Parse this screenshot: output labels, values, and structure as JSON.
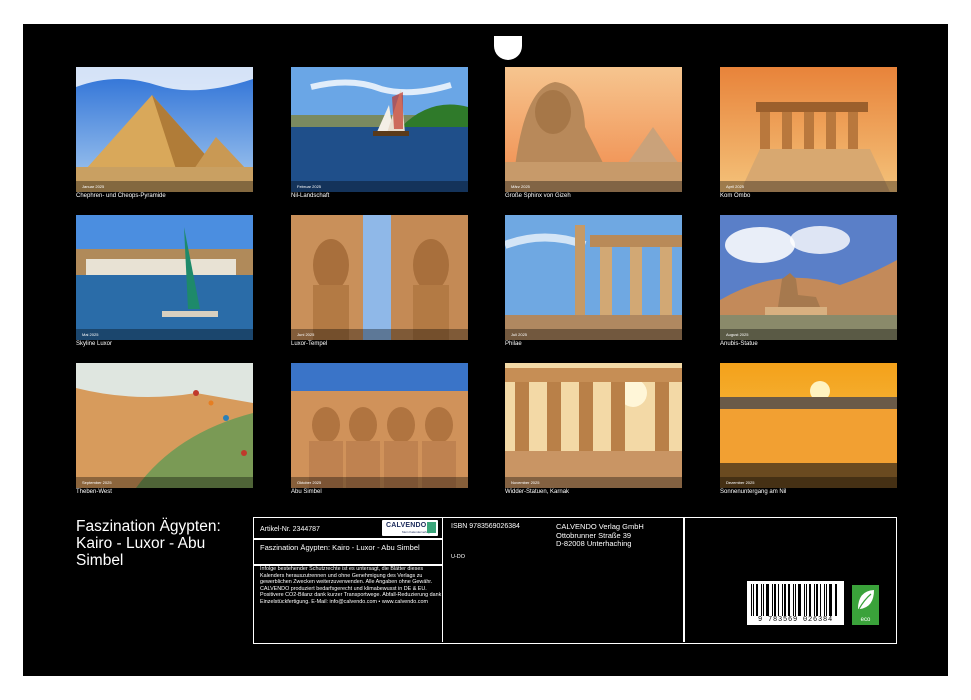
{
  "photos": [
    {
      "caption": "Chephren- und Cheops-Pyramide",
      "month": "Januar 2025"
    },
    {
      "caption": "Nil-Landschaft",
      "month": "Februar 2025"
    },
    {
      "caption": "Große Sphinx von Gizeh",
      "month": "März 2025"
    },
    {
      "caption": "Kom Ombo",
      "month": "April 2025"
    },
    {
      "caption": "Skyline Luxor",
      "month": "Mai 2025"
    },
    {
      "caption": "Luxor-Tempel",
      "month": "Juni 2025"
    },
    {
      "caption": "Philae",
      "month": "Juli 2025"
    },
    {
      "caption": "Anubis-Statue",
      "month": "August 2025"
    },
    {
      "caption": "Theben-West",
      "month": "September 2025"
    },
    {
      "caption": "Abu Simbel",
      "month": "Oktober 2025"
    },
    {
      "caption": "Widder-Statuen, Karnak",
      "month": "November 2025"
    },
    {
      "caption": "Sonnenuntergang am Nil",
      "month": "Dezember 2025"
    }
  ],
  "title": "Faszination Ägypten: Kairo - Luxor - Abu Simbel",
  "info": {
    "article": "Artikel-Nr. 2344787",
    "brand": "CALVENDO",
    "brand_sub": "Mein Kalenderverlag",
    "subtitle": "Faszination Ägypten: Kairo - Luxor - Abu Simbel",
    "legal": "Infolge bestehender Schutzrechte ist es untersagt, die Blätter dieses Kalenders herauszutrennen und ohne Genehmigung des Verlags zu gewerblichen Zwecken weiterzuverwenden. Alle Angaben ohne Gewähr. CALVENDO produziert bedarfsgerecht und klimabewusst in DE & EU. Positivere CO2-Bilanz dank kurzer Transportwege. Abfall-Reduzierung dank Einzelstückfertigung. E-Mail: info@calvendo.com • www.calvendo.com",
    "isbn": "ISBN 9783569026384",
    "udo": "U-DO",
    "publisher": [
      "CALVENDO Verlag GmbH",
      "Ottobrunner Straße 39",
      "D-82008 Unterhaching"
    ],
    "barcode_number": "9 783569 026384",
    "eco_label": "eco"
  }
}
